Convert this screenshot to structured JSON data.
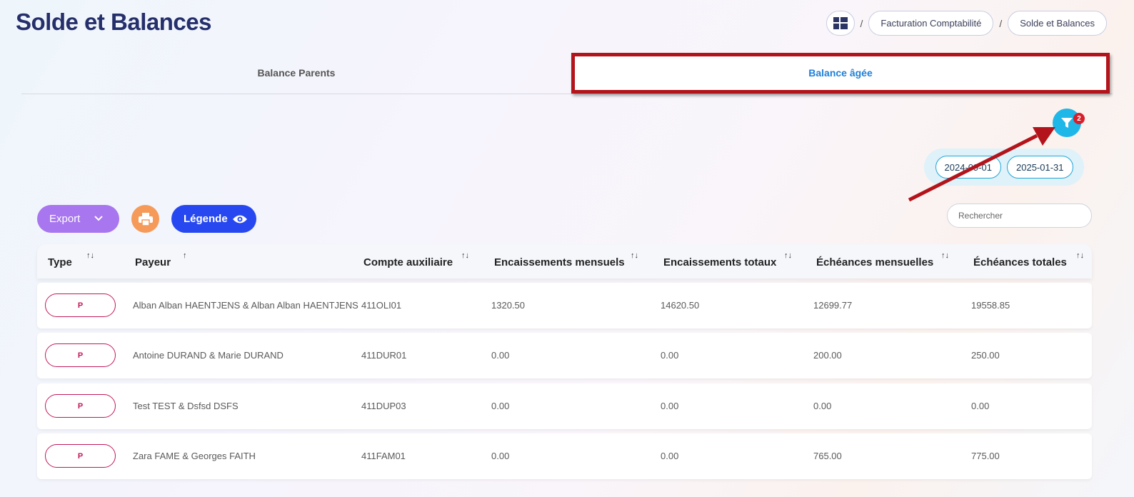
{
  "page_title": "Solde et Balances",
  "breadcrumb": {
    "home_icon": "dashboard-icon",
    "separator": "/",
    "items": [
      "Facturation Comptabilité",
      "Solde et Balances"
    ]
  },
  "tabs": [
    {
      "label": "Balance Parents",
      "active": false
    },
    {
      "label": "Balance âgée",
      "active": true
    }
  ],
  "filter": {
    "icon": "filter-icon",
    "badge_count": "2"
  },
  "date_range": {
    "start": "2024-09-01",
    "end": "2025-01-31"
  },
  "toolbar": {
    "export_label": "Export",
    "print_icon": "printer-icon",
    "legend_label": "Légende",
    "legend_icon": "eye-icon"
  },
  "search": {
    "placeholder": "Rechercher",
    "value": ""
  },
  "table": {
    "columns": [
      "Type",
      "Payeur",
      "Compte auxiliaire",
      "Encaissements mensuels",
      "Encaissements totaux",
      "Échéances mensuelles",
      "Échéances totales"
    ],
    "sort_icons": [
      "↑↓",
      "↑",
      "↑↓",
      "↑↓",
      "↑↓",
      "↑↓",
      "↑↓"
    ],
    "rows": [
      {
        "type": "P",
        "payeur": "Alban Alban HAENTJENS & Alban Alban HAENTJENS",
        "compte": "411OLI01",
        "enc_mens": "1320.50",
        "enc_tot": "14620.50",
        "ech_mens": "12699.77",
        "ech_tot": "19558.85"
      },
      {
        "type": "P",
        "payeur": "Antoine DURAND & Marie DURAND",
        "compte": "411DUR01",
        "enc_mens": "0.00",
        "enc_tot": "0.00",
        "ech_mens": "200.00",
        "ech_tot": "250.00"
      },
      {
        "type": "P",
        "payeur": "Test TEST & Dsfsd DSFS",
        "compte": "411DUP03",
        "enc_mens": "0.00",
        "enc_tot": "0.00",
        "ech_mens": "0.00",
        "ech_tot": "0.00"
      },
      {
        "type": "P",
        "payeur": "Zara FAME & Georges FAITH",
        "compte": "411FAM01",
        "enc_mens": "0.00",
        "enc_tot": "0.00",
        "ech_mens": "765.00",
        "ech_tot": "775.00"
      }
    ]
  },
  "colors": {
    "title": "#252f6b",
    "active_tab": "#1e7fd8",
    "highlight": "#b3131a",
    "filter_button": "#1fb6e8",
    "export_button": "#a876ee",
    "print_button": "#f59a58",
    "legend_button": "#2748f0",
    "type_pill": "#c2185b"
  }
}
